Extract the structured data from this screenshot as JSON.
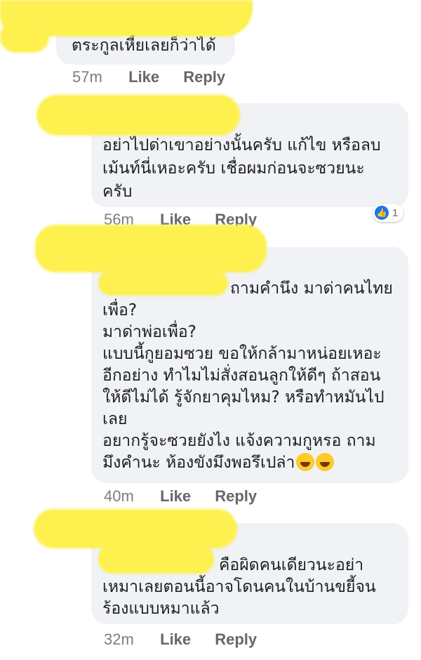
{
  "comments": [
    {
      "lines": [
        "ตระกูลเหี้ยเลยก็ว่าได้"
      ],
      "time": "57m",
      "like_label": "Like",
      "reply_label": "Reply"
    },
    {
      "lines": [
        "อย่าไปด่าเขาอย่างนั้นครับ แก้ไข หรือลบ",
        "เม้นท์นี่เหอะครับ เชื่อผมก่อนจะซวยนะ",
        "ครับ"
      ],
      "time": "56m",
      "like_label": "Like",
      "reply_label": "Reply",
      "reaction": {
        "icon": "like-icon",
        "count": "1"
      }
    },
    {
      "lines": [
        "ถามคำนึง มาด่าคนไทย",
        "เพื่อ?",
        "มาด่าพ่อเพื่อ?",
        "แบบนี้กูยอมซวย ขอให้กล้ามาหน่อยเหอะ",
        "อีกอย่าง ทำไมไม่สั่งสอนลูกให้ดีๆ ถ้าสอน",
        "ให้ดีไม่ได้ รู้จักยาคุมไหม? หรือทำหมันไป",
        "เลย",
        "อยากรู้จะซวยยังไง แจ้งความกูหรอ ถาม",
        "มึงคำนะ ห้องขังมึงพอรึเปล่า"
      ],
      "emoji": [
        "rolling-on-floor-laughing",
        "rolling-on-floor-laughing"
      ],
      "time": "40m",
      "like_label": "Like",
      "reply_label": "Reply"
    },
    {
      "lines": [
        "คือผิดคนเดียวนะอย่า",
        "เหมาเลยตอนนี้อาจโดนคนในบ้านขยี้จน",
        "ร้องแบบหมาแล้ว"
      ],
      "time": "32m",
      "like_label": "Like",
      "reply_label": "Reply"
    }
  ],
  "colors": {
    "bubble": "#f0f2f5",
    "redaction": "#fdf04f",
    "meta": "#65676b",
    "reaction": "#1877f2"
  }
}
